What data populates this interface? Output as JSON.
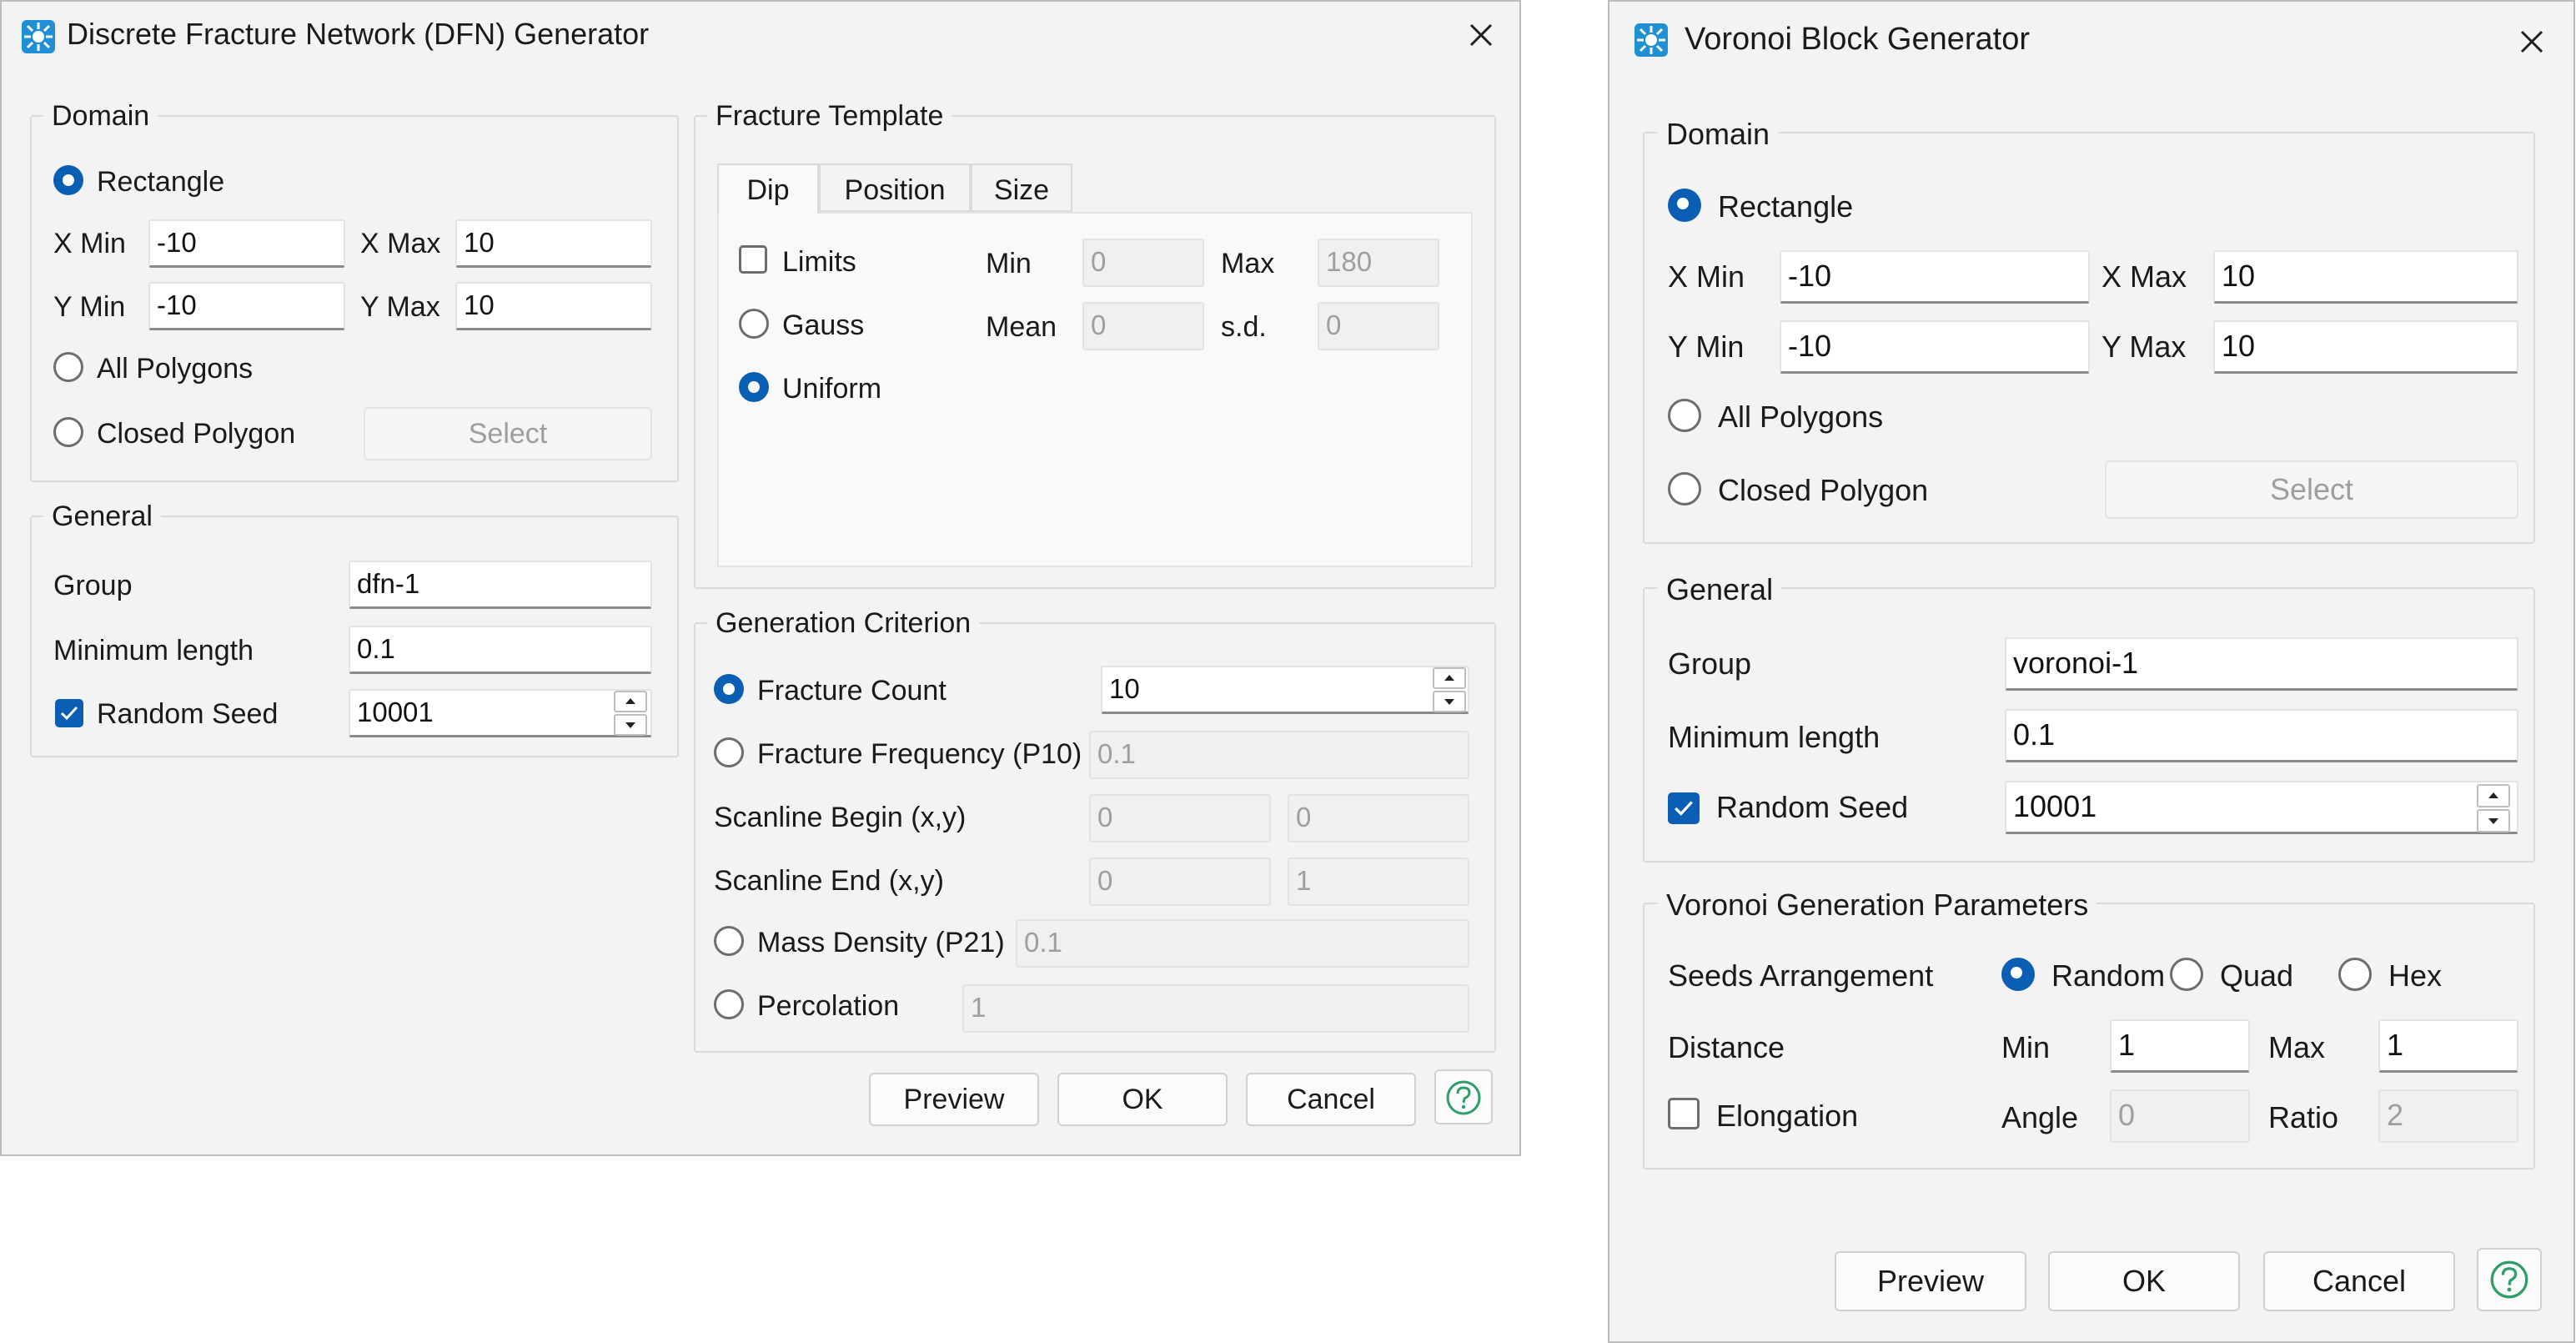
{
  "dfn": {
    "title": "Discrete Fracture Network (DFN) Generator",
    "domain": {
      "title": "Domain",
      "rectangle": "Rectangle",
      "xmin_label": "X Min",
      "xmin": "-10",
      "xmax_label": "X Max",
      "xmax": "10",
      "ymin_label": "Y Min",
      "ymin": "-10",
      "ymax_label": "Y Max",
      "ymax": "10",
      "all_polygons": "All Polygons",
      "closed_polygon": "Closed Polygon",
      "select": "Select"
    },
    "general": {
      "title": "General",
      "group_label": "Group",
      "group": "dfn-1",
      "minlen_label": "Minimum length",
      "minlen": "0.1",
      "seed_label": "Random Seed",
      "seed": "10001"
    },
    "template": {
      "title": "Fracture Template",
      "tabs": [
        "Dip",
        "Position",
        "Size"
      ],
      "limits": "Limits",
      "gauss": "Gauss",
      "uniform": "Uniform",
      "min_label": "Min",
      "min": "0",
      "max_label": "Max",
      "max": "180",
      "mean_label": "Mean",
      "mean": "0",
      "sd_label": "s.d.",
      "sd": "0"
    },
    "criterion": {
      "title": "Generation Criterion",
      "count_label": "Fracture Count",
      "count": "10",
      "freq_label": "Fracture Frequency (P10)",
      "freq": "0.1",
      "scan_begin_label": "Scanline Begin (x,y)",
      "scan_begin_x": "0",
      "scan_begin_y": "0",
      "scan_end_label": "Scanline End (x,y)",
      "scan_end_x": "0",
      "scan_end_y": "1",
      "mass_label": "Mass Density (P21)",
      "mass": "0.1",
      "perc_label": "Percolation",
      "perc": "1"
    },
    "buttons": {
      "preview": "Preview",
      "ok": "OK",
      "cancel": "Cancel"
    }
  },
  "voronoi": {
    "title": "Voronoi Block Generator",
    "domain": {
      "title": "Domain",
      "rectangle": "Rectangle",
      "xmin_label": "X Min",
      "xmin": "-10",
      "xmax_label": "X Max",
      "xmax": "10",
      "ymin_label": "Y Min",
      "ymin": "-10",
      "ymax_label": "Y Max",
      "ymax": "10",
      "all_polygons": "All Polygons",
      "closed_polygon": "Closed Polygon",
      "select": "Select"
    },
    "general": {
      "title": "General",
      "group_label": "Group",
      "group": "voronoi-1",
      "minlen_label": "Minimum length",
      "minlen": "0.1",
      "seed_label": "Random Seed",
      "seed": "10001"
    },
    "params": {
      "title": "Voronoi Generation Parameters",
      "seeds_label": "Seeds Arrangement",
      "random": "Random",
      "quad": "Quad",
      "hex": "Hex",
      "distance_label": "Distance",
      "min_label": "Min",
      "min": "1",
      "max_label": "Max",
      "max": "1",
      "elong_label": "Elongation",
      "angle_label": "Angle",
      "angle": "0",
      "ratio_label": "Ratio",
      "ratio": "2"
    },
    "buttons": {
      "preview": "Preview",
      "ok": "OK",
      "cancel": "Cancel"
    }
  },
  "colors": {
    "accent": "#0a5fb4",
    "window_bg": "#f3f3f3",
    "help_green": "#2e9e6a"
  },
  "icons": {
    "app": "app-logo-icon",
    "close": "close-icon",
    "help": "help-icon"
  }
}
